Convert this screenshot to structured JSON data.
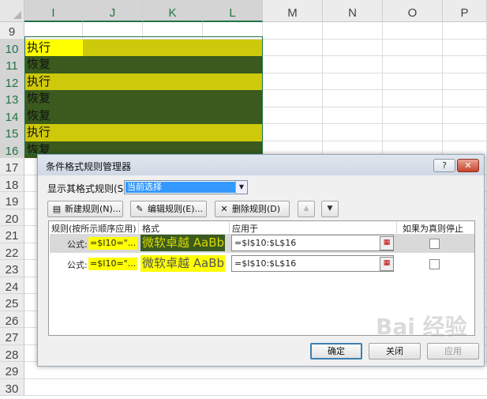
{
  "sheet": {
    "columns": [
      {
        "label": "I",
        "selected": true
      },
      {
        "label": "J",
        "selected": true
      },
      {
        "label": "K",
        "selected": true
      },
      {
        "label": "L",
        "selected": true
      },
      {
        "label": "M",
        "selected": false
      },
      {
        "label": "N",
        "selected": false
      },
      {
        "label": "O",
        "selected": false
      },
      {
        "label": "P",
        "selected": false
      }
    ],
    "rows": [
      {
        "num": "9",
        "text": "",
        "fill": ""
      },
      {
        "num": "10",
        "text": "执行",
        "fill": "yellow",
        "active": true
      },
      {
        "num": "11",
        "text": "恢复",
        "fill": "green"
      },
      {
        "num": "12",
        "text": "执行",
        "fill": "yellow"
      },
      {
        "num": "13",
        "text": "恢复",
        "fill": "green"
      },
      {
        "num": "14",
        "text": "恢复",
        "fill": "green"
      },
      {
        "num": "15",
        "text": "执行",
        "fill": "yellow"
      },
      {
        "num": "16",
        "text": "恢复",
        "fill": "green"
      },
      {
        "num": "17",
        "text": "",
        "fill": ""
      },
      {
        "num": "18",
        "text": "",
        "fill": ""
      },
      {
        "num": "19",
        "text": "",
        "fill": ""
      },
      {
        "num": "20",
        "text": "",
        "fill": ""
      },
      {
        "num": "21",
        "text": "",
        "fill": ""
      },
      {
        "num": "22",
        "text": "",
        "fill": ""
      },
      {
        "num": "23",
        "text": "",
        "fill": ""
      },
      {
        "num": "24",
        "text": "",
        "fill": ""
      },
      {
        "num": "25",
        "text": "",
        "fill": ""
      },
      {
        "num": "26",
        "text": "",
        "fill": ""
      },
      {
        "num": "27",
        "text": "",
        "fill": ""
      },
      {
        "num": "28",
        "text": "",
        "fill": ""
      },
      {
        "num": "29",
        "text": "",
        "fill": ""
      },
      {
        "num": "30",
        "text": "",
        "fill": ""
      }
    ],
    "colors": {
      "yellow_fill": "#cfc90b",
      "green_fill": "#3a5a1e",
      "active_fill": "#ffff00",
      "selection_accent": "#217346"
    }
  },
  "dialog": {
    "title": "条件格式规则管理器",
    "help_label": "?",
    "close_label": "✕",
    "show_rules_label": "显示其格式规则(S):",
    "show_rules_value": "当前选择",
    "toolbar": {
      "new_rule": "新建规则(N)...",
      "edit_rule": "编辑规则(E)...",
      "delete_rule": "删除规则(D)",
      "move_up_icon": "▲",
      "move_down_icon": "▼"
    },
    "columns": {
      "rule": "规则(按所示顺序应用)",
      "format": "格式",
      "applies_to": "应用于",
      "stop_if_true": "如果为真则停止"
    },
    "rules": [
      {
        "type_label": "公式:",
        "formula": "=$I10=\"...",
        "preview": "微软卓越  AaBbCc",
        "preview_style": "green",
        "applies_to": "=$I$10:$L$16",
        "stop_if_true": false,
        "selected": true
      },
      {
        "type_label": "公式:",
        "formula": "=$I10=\"...",
        "preview": "微软卓越  AaBbCc",
        "preview_style": "yellow",
        "applies_to": "=$I$10:$L$16",
        "stop_if_true": false,
        "selected": false
      }
    ],
    "buttons": {
      "ok": "确定",
      "close": "关闭",
      "apply": "应用"
    }
  },
  "watermark": "Bai 经验"
}
